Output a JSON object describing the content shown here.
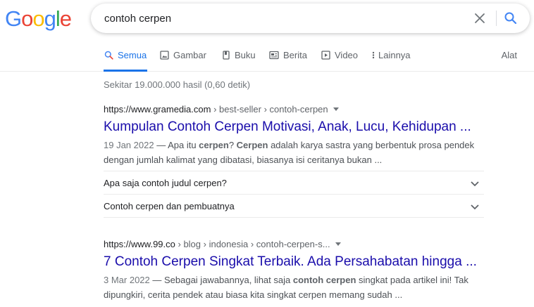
{
  "logo": {
    "letters": [
      "G",
      "o",
      "o",
      "g",
      "l",
      "e"
    ],
    "colors": [
      "#4285f4",
      "#ea4335",
      "#fbbc05",
      "#4285f4",
      "#34a853",
      "#ea4335"
    ]
  },
  "search": {
    "query": "contoh cerpen"
  },
  "tabs": [
    {
      "label": "Semua",
      "icon": "search-icon",
      "active": true
    },
    {
      "label": "Gambar",
      "icon": "image-icon"
    },
    {
      "label": "Buku",
      "icon": "book-icon"
    },
    {
      "label": "Berita",
      "icon": "news-icon"
    },
    {
      "label": "Video",
      "icon": "video-icon"
    },
    {
      "label": "Lainnya",
      "icon": "more-vert-icon"
    }
  ],
  "tools_label": "Alat",
  "stats": "Sekitar 19.000.000 hasil (0,60 detik)",
  "results": [
    {
      "domain": "https://www.gramedia.com",
      "path": " › best-seller › contoh-cerpen",
      "title": "Kumpulan Contoh Cerpen Motivasi, Anak, Lucu, Kehidupan ...",
      "date": "19 Jan 2022",
      "snippet_parts": [
        " — Apa itu ",
        "cerpen",
        "? ",
        "Cerpen",
        " adalah karya sastra yang berbentuk prosa pendek dengan jumlah kalimat yang dibatasi, biasanya isi ceritanya bukan ..."
      ]
    },
    {
      "domain": "https://www.99.co",
      "path": " › blog › indonesia › contoh-cerpen-s...",
      "title": "7 Contoh Cerpen Singkat Terbaik. Ada Persahabatan hingga ...",
      "date": "3 Mar 2022",
      "snippet_parts": [
        " — Sebagai jawabannya, lihat saja ",
        "contoh cerpen",
        " singkat pada artikel ini! Tak dipungkiri, cerita pendek atau biasa kita singkat cerpen memang sudah ..."
      ]
    }
  ],
  "related_questions": [
    "Apa saja contoh judul cerpen?",
    "Contoh cerpen dan pembuatnya"
  ],
  "colors": {
    "link": "#1a0dab",
    "accent": "#1a73e8"
  }
}
